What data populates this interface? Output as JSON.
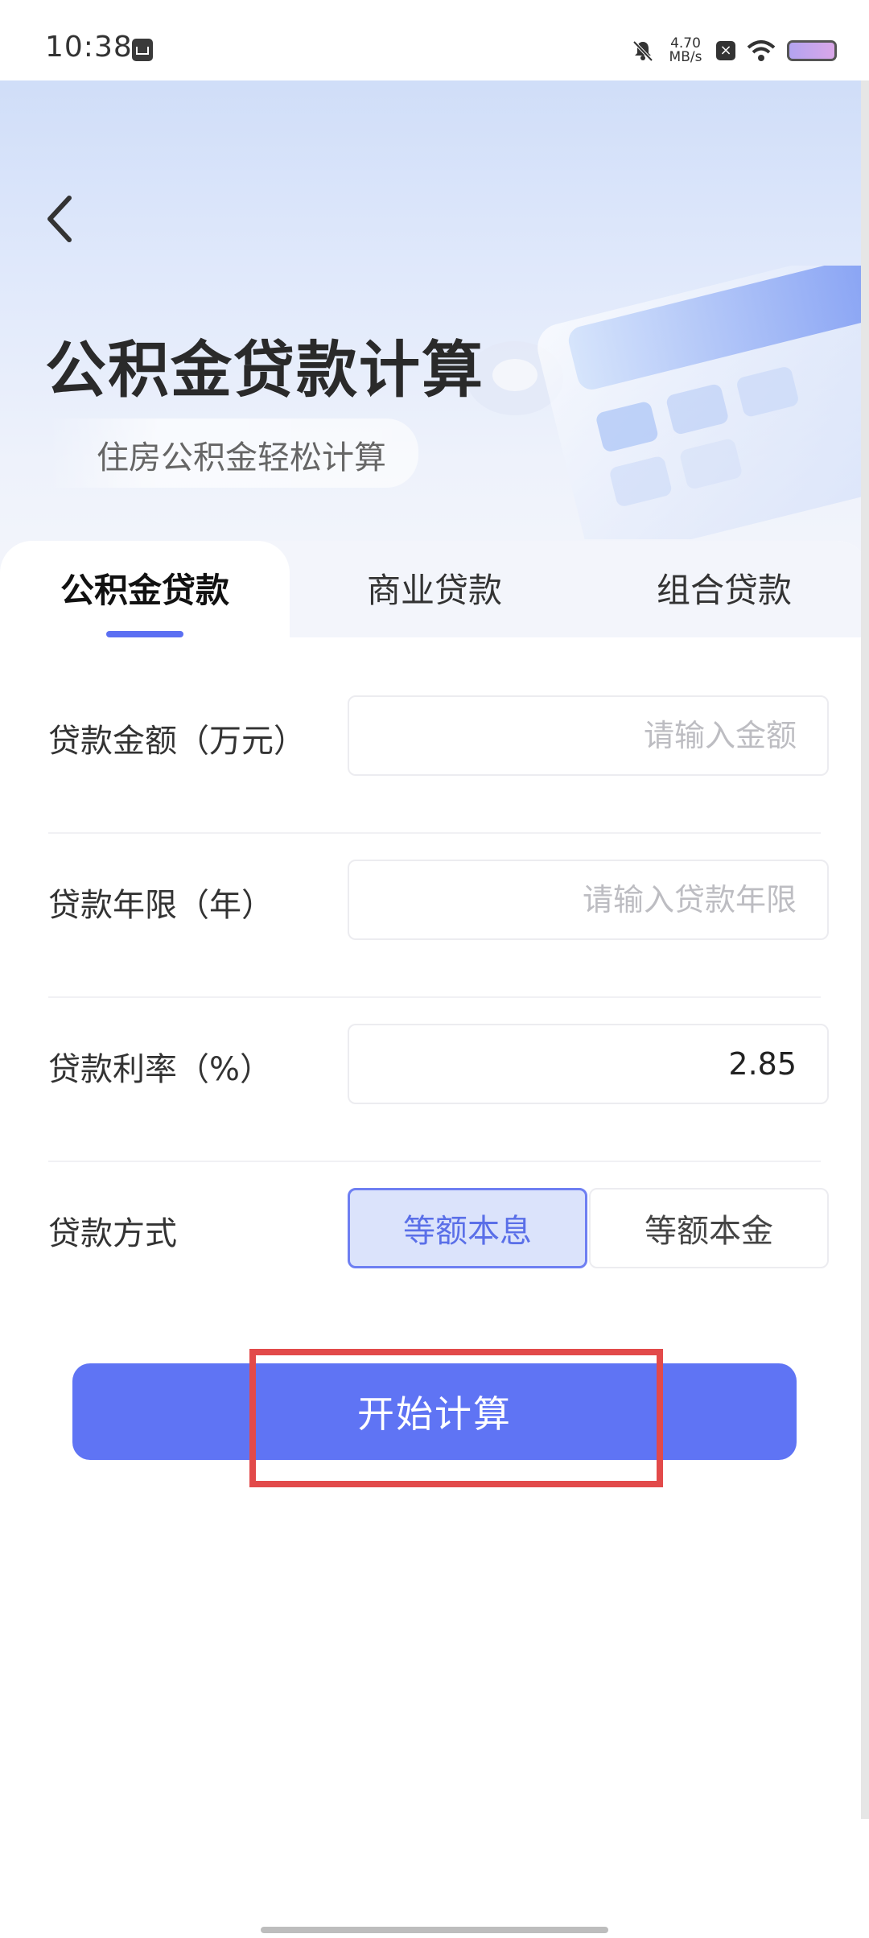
{
  "status_bar": {
    "time": "10:38",
    "speed_value": "4.70",
    "speed_unit": "MB/s",
    "x_badge": "×"
  },
  "header": {
    "title": "公积金贷款计算",
    "subtitle": "住房公积金轻松计算"
  },
  "tabs": [
    {
      "label": "公积金贷款",
      "active": true
    },
    {
      "label": "商业贷款",
      "active": false
    },
    {
      "label": "组合贷款",
      "active": false
    }
  ],
  "form": {
    "amount": {
      "label": "贷款金额（万元）",
      "value": "",
      "placeholder": "请输入金额"
    },
    "years": {
      "label": "贷款年限（年）",
      "value": "",
      "placeholder": "请输入贷款年限"
    },
    "rate": {
      "label": "贷款利率（%）",
      "value": "2.85",
      "placeholder": ""
    },
    "method": {
      "label": "贷款方式",
      "options": [
        {
          "label": "等额本息",
          "selected": true
        },
        {
          "label": "等额本金",
          "selected": false
        }
      ]
    }
  },
  "action": {
    "calculate_label": "开始计算"
  },
  "colors": {
    "accent": "#5f74f4",
    "highlight_box": "#e24a4a",
    "selected_bg": "#dbe3fb"
  }
}
